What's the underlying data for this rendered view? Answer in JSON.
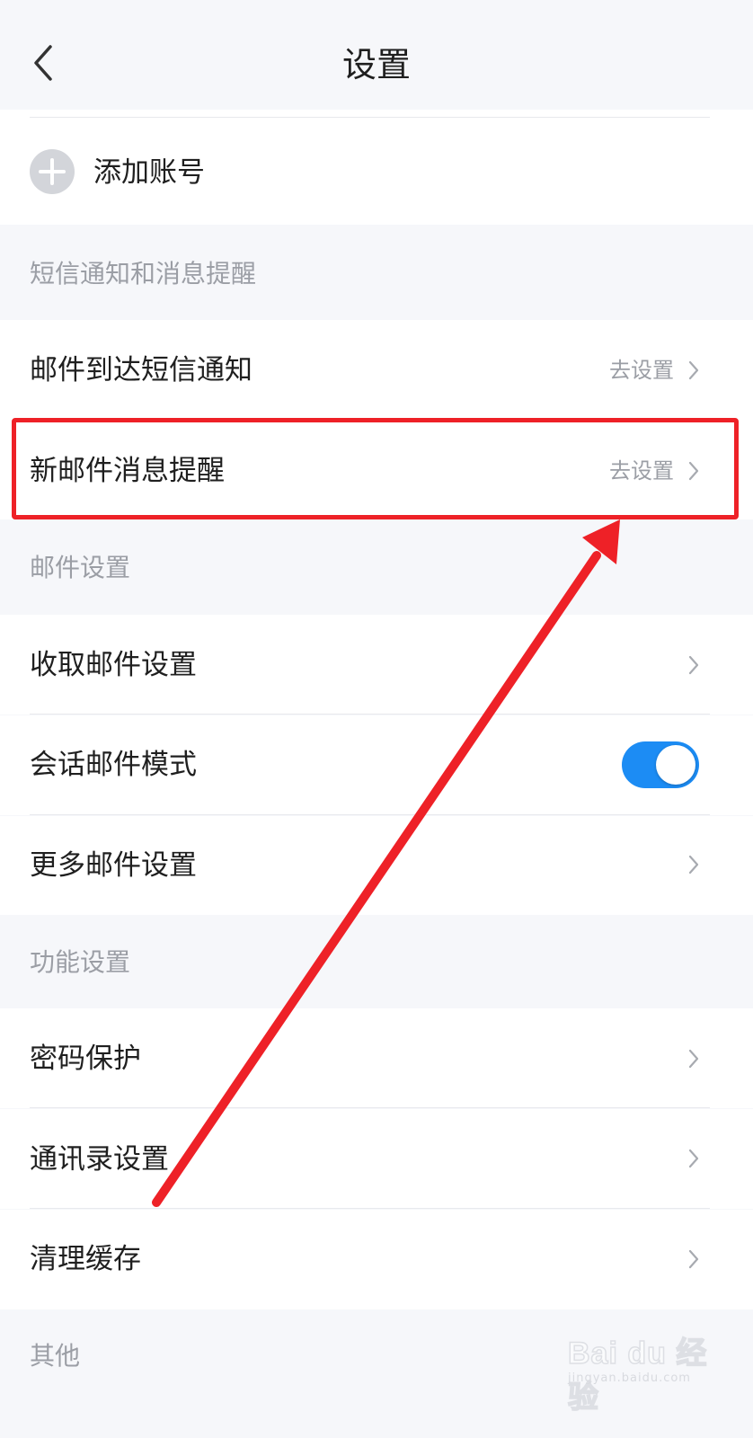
{
  "header": {
    "title": "设置",
    "back_icon": "chevron-left-icon"
  },
  "accounts": {
    "add_label": "添加账号",
    "add_icon": "plus-icon"
  },
  "sections": {
    "sms": {
      "title": "短信通知和消息提醒",
      "items": [
        {
          "label": "邮件到达短信通知",
          "value": "去设置"
        },
        {
          "label": "新邮件消息提醒",
          "value": "去设置"
        }
      ]
    },
    "mail": {
      "title": "邮件设置",
      "items": [
        {
          "label": "收取邮件设置"
        },
        {
          "label": "会话邮件模式",
          "toggle_on": true
        },
        {
          "label": "更多邮件设置"
        }
      ]
    },
    "features": {
      "title": "功能设置",
      "items": [
        {
          "label": "密码保护"
        },
        {
          "label": "通讯录设置"
        },
        {
          "label": "清理缓存"
        }
      ]
    },
    "other": {
      "title": "其他"
    }
  },
  "colors": {
    "background": "#f6f7fa",
    "toggle_on": "#1c8cf4",
    "annotation_red": "#ee2127",
    "secondary_text": "#9b9ea5"
  },
  "watermark": {
    "main": "Bai du 经验",
    "sub": "jingyan.baidu.com"
  }
}
